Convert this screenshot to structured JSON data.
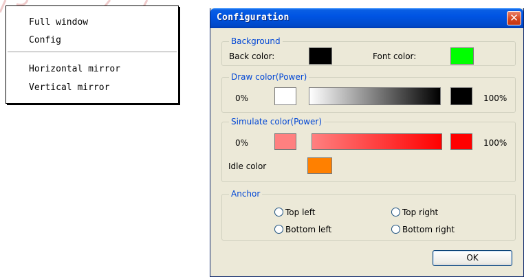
{
  "context_menu": {
    "items": [
      "Full window",
      "Config",
      "Horizontal mirror",
      "Vertical mirror"
    ]
  },
  "dialog": {
    "title": "Configuration",
    "close_glyph": "✕",
    "background": {
      "legend": "Background",
      "back_color_label": "Back color:",
      "font_color_label": "Font color:",
      "back_color": "#000000",
      "font_color": "#00ff00"
    },
    "draw": {
      "legend": "Draw color(Power)",
      "min_label": "0%",
      "max_label": "100%",
      "min_color": "#ffffff",
      "max_color": "#000000"
    },
    "simulate": {
      "legend": "Simulate color(Power)",
      "min_label": "0%",
      "max_label": "100%",
      "min_color": "#ff8080",
      "max_color": "#ff0000",
      "idle_label": "Idle color",
      "idle_color": "#ff8000"
    },
    "anchor": {
      "legend": "Anchor",
      "options": [
        "Top left",
        "Top right",
        "Bottom left",
        "Bottom right"
      ]
    },
    "ok_label": "OK"
  }
}
